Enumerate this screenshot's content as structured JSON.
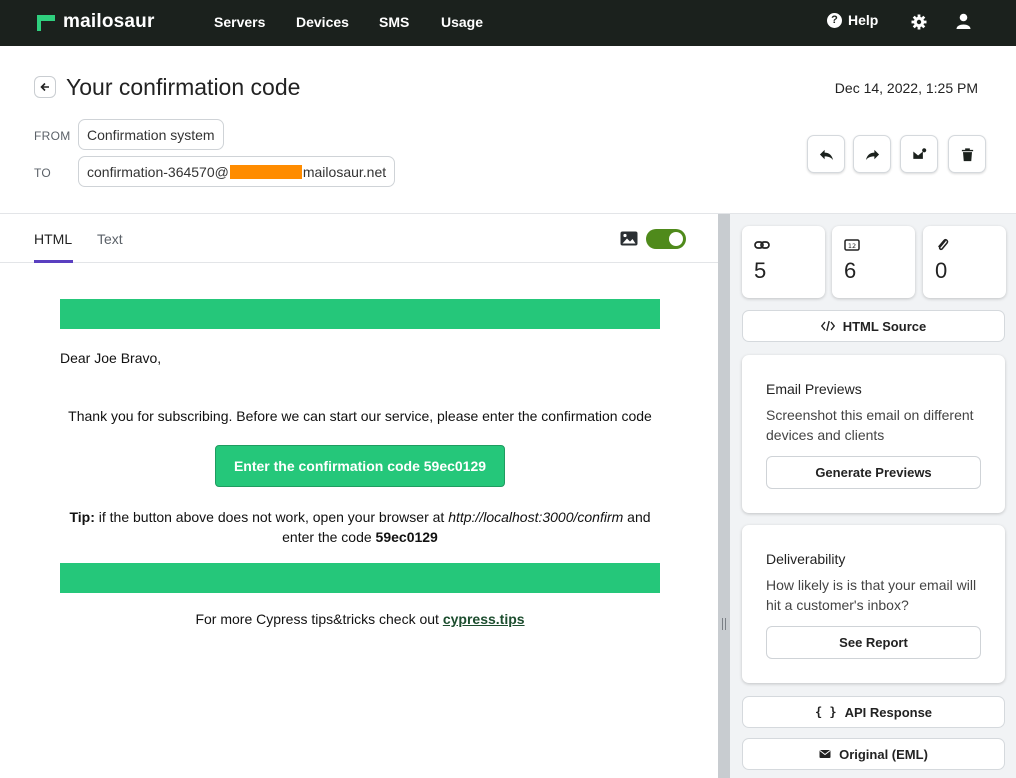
{
  "nav": {
    "brand": "mailosaur",
    "links": [
      "Servers",
      "Devices",
      "SMS",
      "Usage"
    ],
    "help": "Help"
  },
  "message": {
    "subject": "Your confirmation code",
    "date": "Dec 14, 2022, 1:25 PM",
    "from_label": "FROM",
    "from": "Confirmation system",
    "to_label": "TO",
    "to_prefix": "confirmation-364570@",
    "to_suffix": "mailosaur.net"
  },
  "actions": [
    "reply-icon",
    "forward-icon",
    "mark-unread-icon",
    "trash-icon"
  ],
  "tabs": {
    "html": "HTML",
    "text": "Text"
  },
  "email": {
    "greeting": "Dear Joe Bravo,",
    "thanks": "Thank you for subscribing. Before we can start our service, please enter the confirmation code",
    "cta": "Enter the confirmation code 59ec0129",
    "tip_label": "Tip:",
    "tip_text": " if the button above does not work, open your browser at ",
    "tip_url": "http://localhost:3000/confirm",
    "tip_and": " and enter the code ",
    "tip_code": "59ec0129",
    "more_text": "For more Cypress tips&tricks check out ",
    "more_link": "cypress.tips"
  },
  "stats": [
    {
      "icon": "link-icon",
      "value": "5"
    },
    {
      "icon": "number-icon",
      "value": "6"
    },
    {
      "icon": "paperclip-icon",
      "value": "0"
    }
  ],
  "sidebar": {
    "html_source": "HTML Source",
    "previews_title": "Email Previews",
    "previews_desc": "Screenshot this email on different devices and clients",
    "previews_btn": "Generate Previews",
    "deliv_title": "Deliverability",
    "deliv_desc": "How likely is is that your email will hit a customer's inbox?",
    "deliv_btn": "See Report",
    "api_response": "API Response",
    "original": "Original (EML)"
  },
  "colors": {
    "nav": "#1b211d",
    "accent_green": "#25c77a",
    "toggle": "#4f8a1b",
    "tab_underline": "#5a3fc0",
    "redaction": "#ff8c00"
  }
}
